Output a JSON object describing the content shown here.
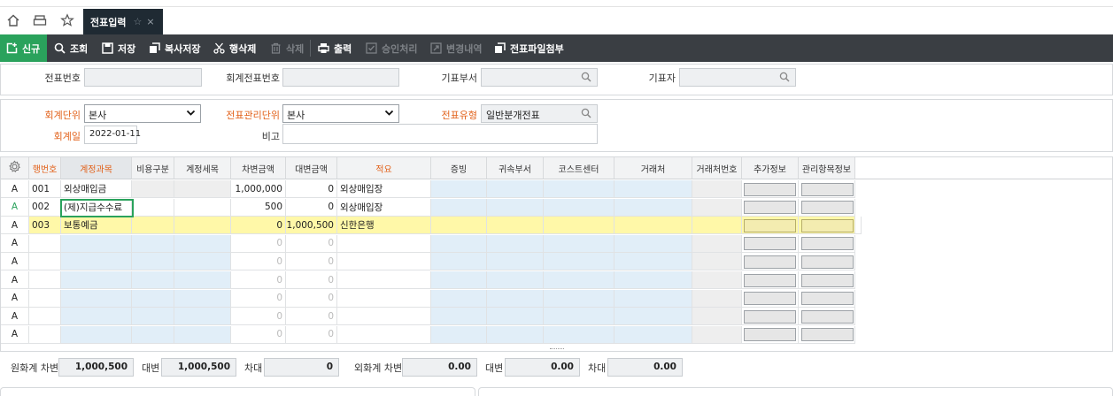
{
  "tabs": {
    "active_label": "전표입력"
  },
  "toolbar": {
    "new": "신규",
    "search": "조회",
    "save": "저장",
    "copy_save": "복사저장",
    "delete_row": "행삭제",
    "delete": "삭제",
    "print": "출력",
    "approve": "승인처리",
    "history": "변경내역",
    "attach": "전표파일첨부"
  },
  "header": {
    "voucher_no_label": "전표번호",
    "voucher_no": "",
    "acct_voucher_no_label": "회계전표번호",
    "acct_voucher_no": "",
    "dept_label": "기표부서",
    "dept": "",
    "writer_label": "기표자",
    "writer": ""
  },
  "form": {
    "unit_label": "회계단위",
    "unit": "본사",
    "mgmt_unit_label": "전표관리단위",
    "mgmt_unit": "본사",
    "type_label": "전표유형",
    "type": "일반분개전표",
    "date_label": "회계일",
    "date": "2022-01-11",
    "memo_label": "비고",
    "memo": ""
  },
  "grid": {
    "columns": [
      "행번호",
      "계정과목",
      "비용구분",
      "계정세목",
      "차변금액",
      "대변금액",
      "적요",
      "증빙",
      "귀속부서",
      "코스트센터",
      "거래처",
      "거래처번호",
      "추가정보",
      "관리항목정보"
    ],
    "rows": [
      {
        "flag": "A",
        "no": "001",
        "account": "외상매입금",
        "debit": "1,000,000",
        "credit": "0",
        "memo": "외상매입장"
      },
      {
        "flag": "A",
        "no": "002",
        "account": "(제)지급수수료",
        "debit": "500",
        "credit": "0",
        "memo": "외상매입장"
      },
      {
        "flag": "A",
        "no": "003",
        "account": "보통예금",
        "debit": "0",
        "credit": "1,000,500",
        "memo": "신한은행"
      },
      {
        "flag": "A",
        "no": "",
        "account": "",
        "debit": "0",
        "credit": "0",
        "memo": ""
      },
      {
        "flag": "A",
        "no": "",
        "account": "",
        "debit": "0",
        "credit": "0",
        "memo": ""
      },
      {
        "flag": "A",
        "no": "",
        "account": "",
        "debit": "0",
        "credit": "0",
        "memo": ""
      },
      {
        "flag": "A",
        "no": "",
        "account": "",
        "debit": "0",
        "credit": "0",
        "memo": ""
      },
      {
        "flag": "A",
        "no": "",
        "account": "",
        "debit": "0",
        "credit": "0",
        "memo": ""
      },
      {
        "flag": "A",
        "no": "",
        "account": "",
        "debit": "0",
        "credit": "0",
        "memo": ""
      }
    ]
  },
  "summary": {
    "krw_debit_label": "원화계 차변",
    "krw_debit": "1,000,500",
    "krw_credit_label": "대변",
    "krw_credit": "1,000,500",
    "krw_diff_label": "차대",
    "krw_diff": "0",
    "fx_debit_label": "외화계 차변",
    "fx_debit": "0.00",
    "fx_credit_label": "대변",
    "fx_credit": "0.00",
    "fx_diff_label": "차대",
    "fx_diff": "0.00"
  },
  "colors": {
    "accent_green": "#2aa25c",
    "toolbar_bg": "#3a3e43",
    "required_label": "#e2621b",
    "highlight_row": "#fff8a8",
    "editable_cell": "#e1eef8"
  }
}
